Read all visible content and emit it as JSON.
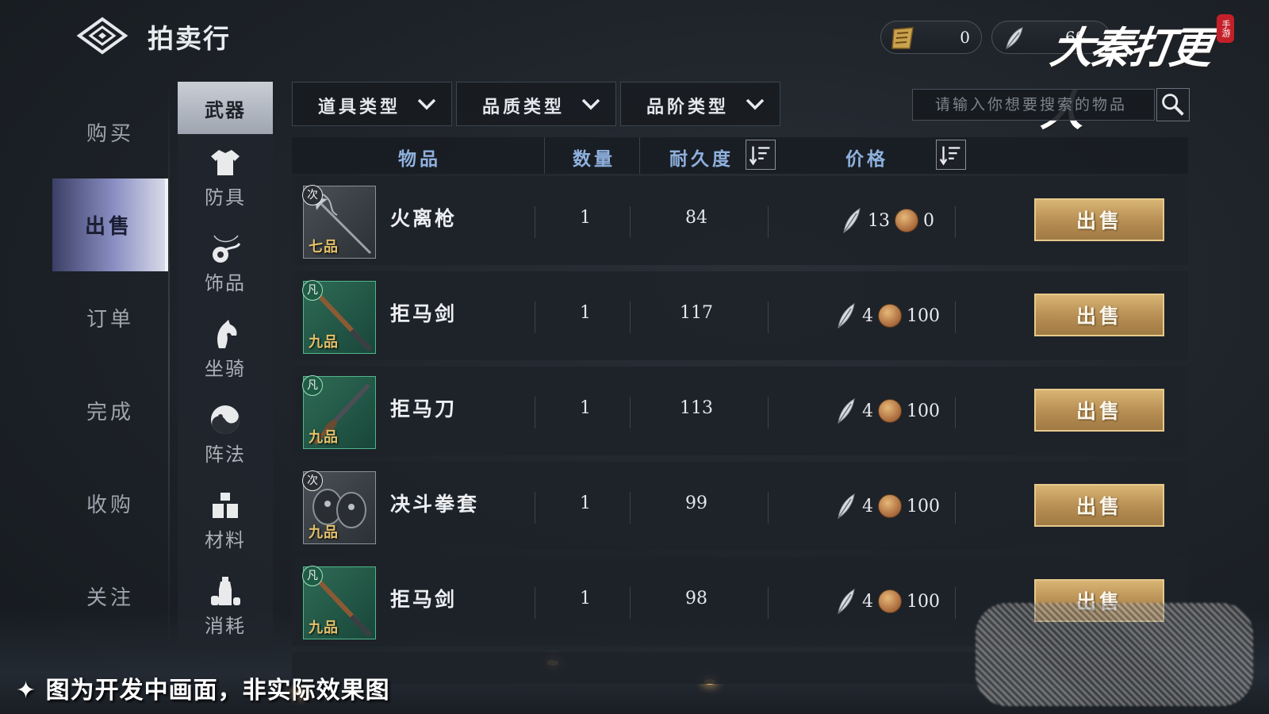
{
  "header": {
    "title": "拍卖行",
    "currency_scroll": "0",
    "currency_feather": "60",
    "game_logo": "大秦打更人",
    "logo_seal": "手游"
  },
  "left_nav": [
    {
      "label": "购买",
      "active": false
    },
    {
      "label": "出售",
      "active": true
    },
    {
      "label": "订单",
      "active": false
    },
    {
      "label": "完成",
      "active": false
    },
    {
      "label": "收购",
      "active": false
    },
    {
      "label": "关注",
      "active": false
    }
  ],
  "categories": [
    {
      "label": "武器",
      "icon": "sword-icon",
      "active": true
    },
    {
      "label": "防具",
      "icon": "shirt-icon",
      "active": false
    },
    {
      "label": "饰品",
      "icon": "pendant-icon",
      "active": false
    },
    {
      "label": "坐骑",
      "icon": "horse-icon",
      "active": false
    },
    {
      "label": "阵法",
      "icon": "yin-yang-icon",
      "active": false
    },
    {
      "label": "材料",
      "icon": "blocks-icon",
      "active": false
    },
    {
      "label": "消耗",
      "icon": "bottle-icon",
      "active": false
    }
  ],
  "filters": {
    "item_type": "道具类型",
    "quality_type": "品质类型",
    "rank_type": "品阶类型"
  },
  "search": {
    "placeholder": "请输入你想要搜索的物品"
  },
  "table": {
    "headers": {
      "item": "物品",
      "quantity": "数量",
      "durability": "耐久度",
      "price": "价格"
    },
    "sell_label": "出售",
    "rows": [
      {
        "name": "火离枪",
        "grade": "次",
        "rank": "七品",
        "quantity": "1",
        "durability": "84",
        "price_feather": "13",
        "price_coin": "0"
      },
      {
        "name": "拒马剑",
        "grade": "凡",
        "rank": "九品",
        "quantity": "1",
        "durability": "117",
        "price_feather": "4",
        "price_coin": "100"
      },
      {
        "name": "拒马刀",
        "grade": "凡",
        "rank": "九品",
        "quantity": "1",
        "durability": "113",
        "price_feather": "4",
        "price_coin": "100"
      },
      {
        "name": "决斗拳套",
        "grade": "次",
        "rank": "九品",
        "quantity": "1",
        "durability": "99",
        "price_feather": "4",
        "price_coin": "100"
      },
      {
        "name": "拒马剑",
        "grade": "凡",
        "rank": "九品",
        "quantity": "1",
        "durability": "98",
        "price_feather": "4",
        "price_coin": "100"
      }
    ]
  },
  "caption": "✦ 图为开发中画面，非实际效果图",
  "colors": {
    "accent_blue": "#8fb1de",
    "sell_gold": "#b99055",
    "active_nav": "#8a8fc3"
  }
}
